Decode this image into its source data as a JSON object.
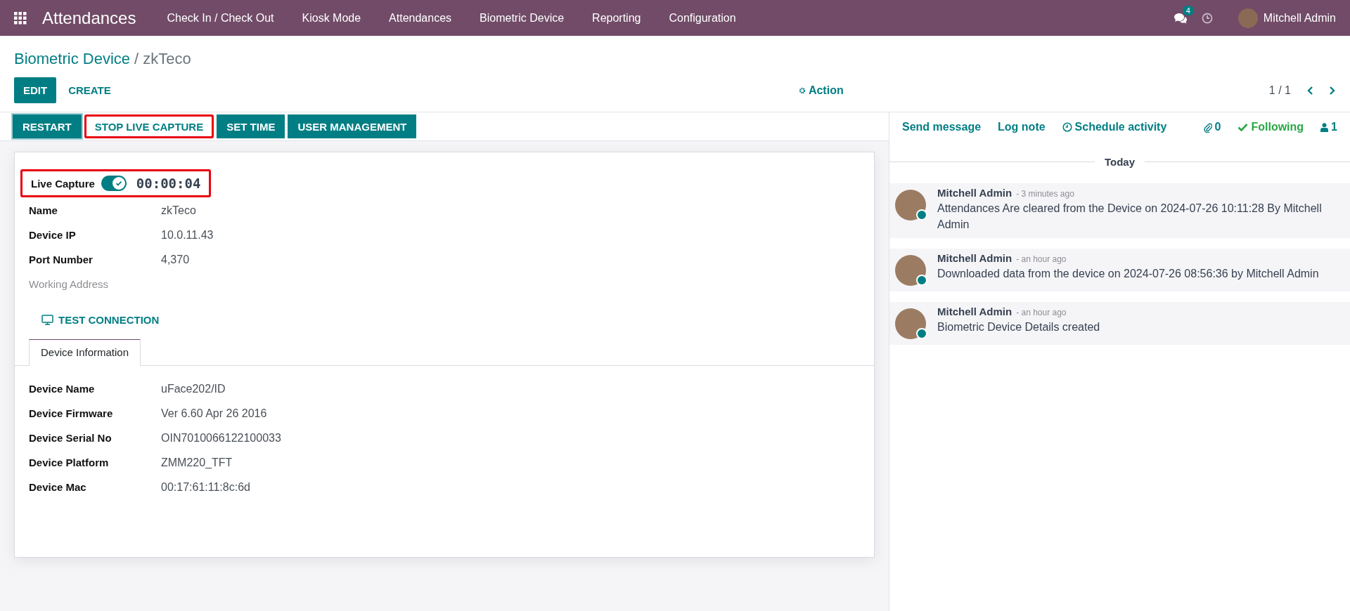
{
  "navbar": {
    "app_name": "Attendances",
    "menu": [
      "Check In / Check Out",
      "Kiosk Mode",
      "Attendances",
      "Biometric Device",
      "Reporting",
      "Configuration"
    ],
    "messages_badge": "4",
    "user": "Mitchell Admin"
  },
  "breadcrumb": {
    "parent": "Biometric Device",
    "separator": "/",
    "current": "zkTeco"
  },
  "control_panel": {
    "buttons": [
      "EDIT",
      "CREATE"
    ],
    "action": "Action",
    "pager": "1 / 1"
  },
  "header_buttons": [
    {
      "label": "RESTART",
      "highlighted": false
    },
    {
      "label": "STOP LIVE CAPTURE",
      "highlighted": true
    },
    {
      "label": "SET TIME",
      "highlighted": false
    },
    {
      "label": "USER MANAGEMENT",
      "highlighted": false
    }
  ],
  "live_capture": {
    "label": "Live Capture",
    "on": true,
    "timer": "00:00:04",
    "highlighted": true
  },
  "fields": [
    {
      "label": "Name",
      "value": "zkTeco",
      "required": true
    },
    {
      "label": "Device IP",
      "value": "10.0.11.43",
      "required": true
    },
    {
      "label": "Port Number",
      "value": "4,370",
      "required": true
    },
    {
      "label": "Working Address",
      "required": false
    }
  ],
  "test_button": "TEST CONNECTION",
  "tabs": [
    {
      "label": "Device Information",
      "selected": true
    }
  ],
  "device_info": [
    {
      "label": "Device Name",
      "value": "uFace202/ID"
    },
    {
      "label": "Device Firmware",
      "value": "Ver 6.60 Apr 26 2016"
    },
    {
      "label": "Device Serial No",
      "value": "OIN7010066122100033"
    },
    {
      "label": "Device Platform",
      "value": "ZMM220_TFT"
    },
    {
      "label": "Device Mac",
      "value": "00:17:61:11:8c:6d"
    }
  ],
  "chatter": {
    "send_message": "Send message",
    "log_note": "Log note",
    "schedule_activity": "Schedule activity",
    "attachments": "0",
    "following": "Following",
    "followers": "1",
    "date_separator": "Today",
    "messages": [
      {
        "author": "Mitchell Admin",
        "time": "- 3 minutes ago",
        "body": "Attendances Are cleared from the Device on 2024-07-26 10:11:28 By Mitchell Admin",
        "online": true
      },
      {
        "author": "Mitchell Admin",
        "time": "- an hour ago",
        "body": "Downloaded data from the device on 2024-07-26 08:56:36 by Mitchell Admin",
        "online": true
      },
      {
        "author": "Mitchell Admin",
        "time": "- an hour ago",
        "body": "Biometric Device Details created",
        "online": true
      }
    ]
  }
}
